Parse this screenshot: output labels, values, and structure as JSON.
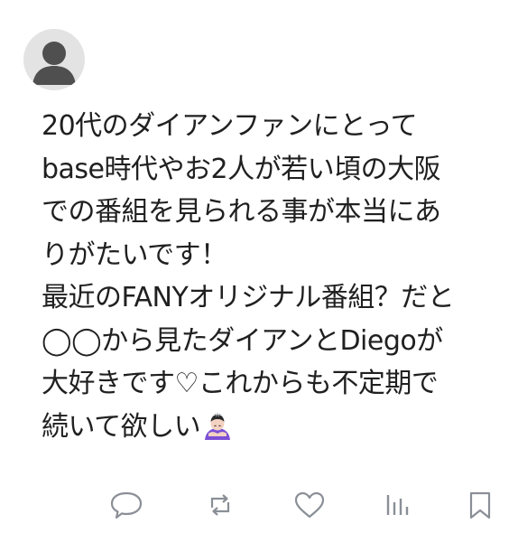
{
  "post": {
    "text": "20代のダイアンファンにとって\nbase時代やお2人が若い頃の大阪\nでの番組を見られる事が本当にあ\nりがたいです！\n最近のFANYオリジナル番組？だと\n◯◯から見たダイアンとDiegoが\n大好きです♡これからも不定期で\n続いて欲しい",
    "emoji": "person-bowing-emoji"
  },
  "avatar": {
    "icon": "default-user-icon"
  },
  "actions": {
    "reply": "reply-icon",
    "repost": "repost-icon",
    "like": "heart-icon",
    "stats": "analytics-icon",
    "bookmark": "bookmark-icon"
  },
  "colors": {
    "text": "#202020",
    "icon": "#8a8f96",
    "avatar_bg": "#e3e3e3",
    "avatar_fg": "#4f4f4f"
  }
}
